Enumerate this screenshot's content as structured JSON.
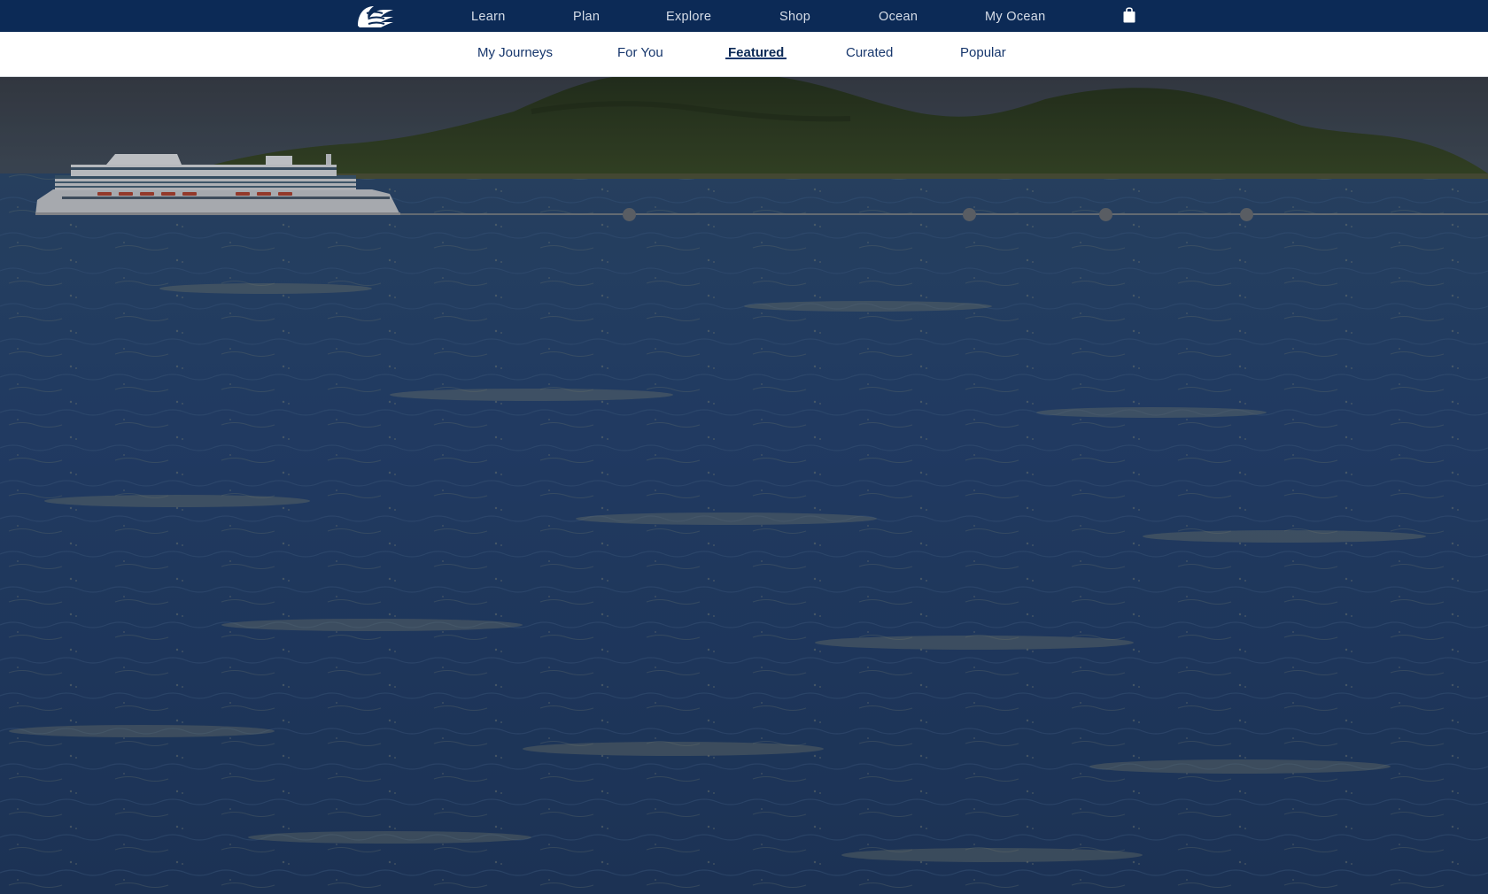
{
  "topnav": {
    "logo_icon": "wave-logo-icon",
    "items": [
      {
        "label": "Learn"
      },
      {
        "label": "Plan"
      },
      {
        "label": "Explore"
      },
      {
        "label": "Shop"
      },
      {
        "label": "Ocean"
      },
      {
        "label": "My Ocean"
      }
    ],
    "bag_icon": "shopping-bag-icon"
  },
  "subnav": {
    "items": [
      {
        "label": "My Journeys"
      },
      {
        "label": "For You"
      },
      {
        "label": "Featured"
      },
      {
        "label": "Curated"
      },
      {
        "label": "Popular"
      }
    ],
    "active": "Featured"
  },
  "hero": {
    "ship_icon": "cruise-ship-icon",
    "progress_dot_count": 4
  },
  "colors": {
    "topbar": "#0c2a56",
    "subnav_text": "#16366c",
    "ocean": "#24426e",
    "island": "#2d3b1c"
  }
}
